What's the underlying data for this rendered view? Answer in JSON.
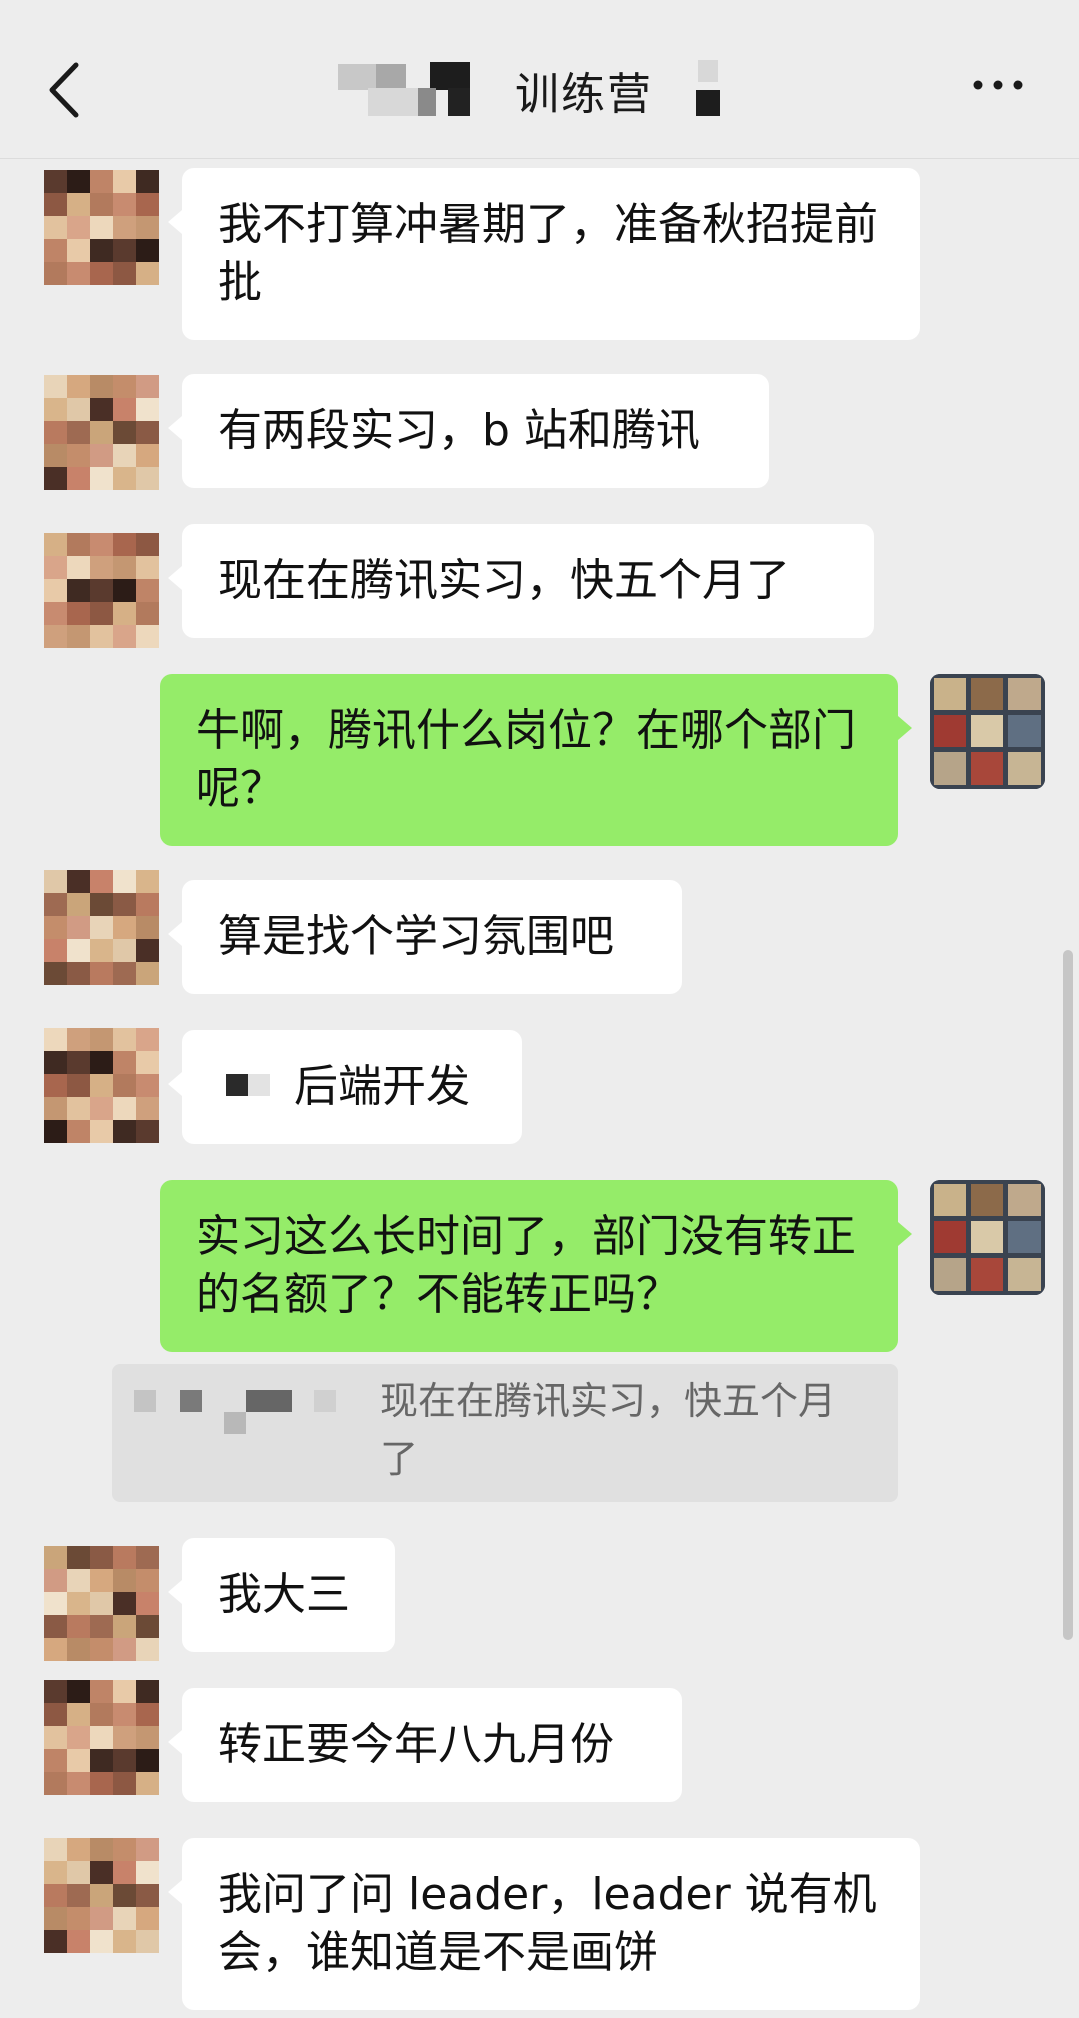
{
  "header": {
    "title": "训练营",
    "back_icon": "chevron-left-icon",
    "more_icon": "more-horizontal-icon"
  },
  "messages": [
    {
      "side": "left",
      "text": "我不打算冲暑期了，准备秋招提前批"
    },
    {
      "side": "left",
      "text": "有两段实习，b 站和腾讯"
    },
    {
      "side": "left",
      "text": "现在在腾讯实习，快五个月了"
    },
    {
      "side": "right",
      "text": "牛啊，腾讯什么岗位？在哪个部门呢？"
    },
    {
      "side": "left",
      "text": "算是找个学习氛围吧"
    },
    {
      "side": "left",
      "text": "后端开发"
    },
    {
      "side": "right",
      "text": "实习这么长时间了，部门没有转正的名额了？不能转正吗？"
    },
    {
      "side": "quote",
      "text": "现在在腾讯实习，快五个月了"
    },
    {
      "side": "left",
      "text": "我大三"
    },
    {
      "side": "left",
      "text": "转正要今年八九月份"
    },
    {
      "side": "left",
      "text": "我问了问 leader，leader 说有机会，谁知道是不是画饼"
    }
  ],
  "colors": {
    "background": "#ededed",
    "self_bubble": "#95ec69",
    "other_bubble": "#ffffff"
  }
}
